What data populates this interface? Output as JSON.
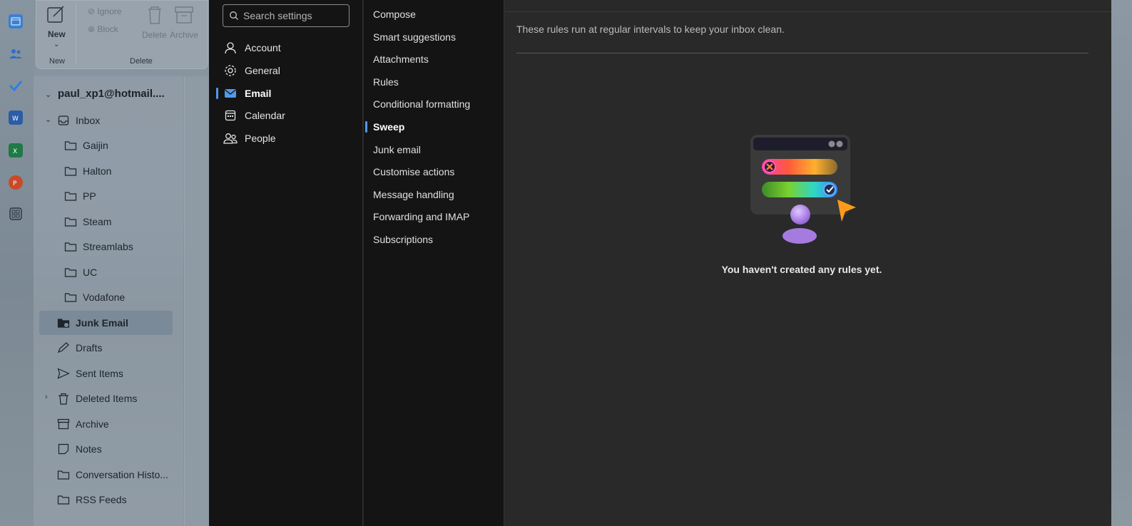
{
  "ribbon": {
    "new_label": "New",
    "new_group": "New",
    "ignore": "Ignore",
    "block": "Block",
    "delete": "Delete",
    "archive": "Archive",
    "delete_group": "Delete"
  },
  "folders": {
    "account": "paul_xp1@hotmail....",
    "items": [
      {
        "label": "Inbox"
      },
      {
        "label": "Gaijin"
      },
      {
        "label": "Halton"
      },
      {
        "label": "PP"
      },
      {
        "label": "Steam"
      },
      {
        "label": "Streamlabs"
      },
      {
        "label": "UC"
      },
      {
        "label": "Vodafone"
      },
      {
        "label": "Junk Email"
      },
      {
        "label": "Drafts"
      },
      {
        "label": "Sent Items"
      },
      {
        "label": "Deleted Items"
      },
      {
        "label": "Archive"
      },
      {
        "label": "Notes"
      },
      {
        "label": "Conversation Histo..."
      },
      {
        "label": "RSS Feeds"
      }
    ]
  },
  "settings": {
    "search_placeholder": "Search settings",
    "categories": [
      {
        "label": "Account",
        "icon": "person-icon"
      },
      {
        "label": "General",
        "icon": "gear-icon"
      },
      {
        "label": "Email",
        "icon": "mail-icon"
      },
      {
        "label": "Calendar",
        "icon": "calendar-icon"
      },
      {
        "label": "People",
        "icon": "people-icon"
      }
    ],
    "active_category": "Email",
    "subcategories": [
      {
        "label": "Compose"
      },
      {
        "label": "Smart suggestions"
      },
      {
        "label": "Attachments"
      },
      {
        "label": "Rules"
      },
      {
        "label": "Conditional formatting"
      },
      {
        "label": "Sweep"
      },
      {
        "label": "Junk email"
      },
      {
        "label": "Customise actions"
      },
      {
        "label": "Message handling"
      },
      {
        "label": "Forwarding and IMAP"
      },
      {
        "label": "Subscriptions"
      }
    ],
    "active_subcategory": "Sweep"
  },
  "content": {
    "description": "These rules run at regular intervals to keep your inbox clean.",
    "empty_message": "You haven't created any rules yet."
  },
  "colors": {
    "accent": "#4f9bea",
    "dialog_bg": "#292929",
    "nav_bg": "#141414"
  }
}
